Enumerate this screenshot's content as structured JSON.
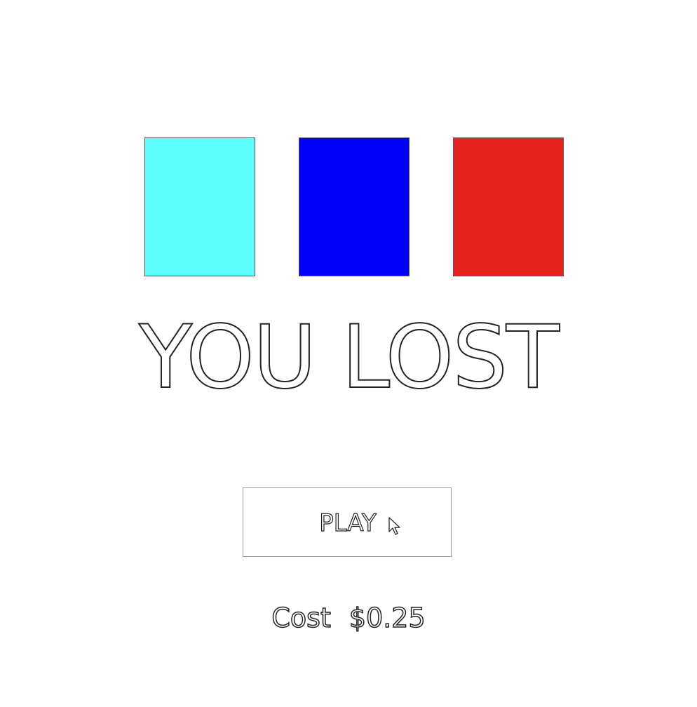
{
  "reels": [
    {
      "color": "#5ffffd"
    },
    {
      "color": "#0000fd"
    },
    {
      "color": "#e5241f"
    }
  ],
  "result_text": "YOU LOST",
  "play_button": {
    "label": "PLAY"
  },
  "cost": {
    "label": "Cost",
    "value": "$0.25"
  }
}
